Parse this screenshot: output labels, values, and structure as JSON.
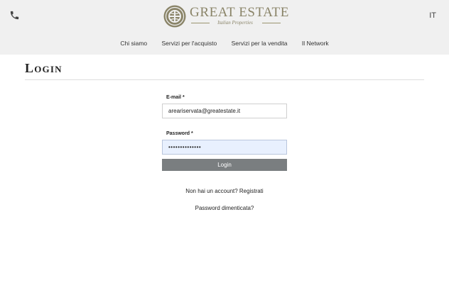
{
  "header": {
    "logo": {
      "title": "GREAT ESTATE",
      "subtitle": "Italian Properties"
    },
    "language": "IT",
    "icons": {
      "phone": "phone-icon",
      "logo": "globe-seal-icon"
    },
    "colors": {
      "background": "#f0f0f0",
      "brand": "#8a8468"
    }
  },
  "nav": [
    {
      "label": "Chi siamo"
    },
    {
      "label": "Servizi per l'acquisto"
    },
    {
      "label": "Servizi per la vendita"
    },
    {
      "label": "Il Network"
    }
  ],
  "page": {
    "title": "Login"
  },
  "form": {
    "email_label": "E-mail *",
    "email_value": "areariservata@greatestate.it",
    "password_label": "Password *",
    "password_value": "••••••••••••••",
    "login_label": "Login",
    "button_color": "#7a7e80",
    "autofill_color": "#e8f0fe"
  },
  "links": {
    "register": "Non hai un account? Registrati",
    "forgot": "Password dimenticata?"
  }
}
